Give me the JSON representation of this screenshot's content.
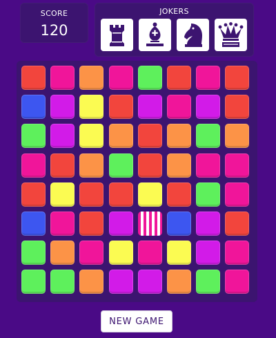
{
  "score": {
    "label": "SCORE",
    "value": "120"
  },
  "jokers": {
    "label": "JOKERS",
    "items": [
      {
        "piece": "rook",
        "icon": "rook-icon"
      },
      {
        "piece": "bishop",
        "icon": "bishop-icon"
      },
      {
        "piece": "knight",
        "icon": "knight-icon"
      },
      {
        "piece": "queen",
        "icon": "queen-icon"
      }
    ]
  },
  "colors": {
    "background": "#4a0a86",
    "panel": "#3c1470",
    "red": "#f2453d",
    "magenta": "#f0159a",
    "orange": "#fc9347",
    "green": "#5ef05c",
    "blue": "#3d56f0",
    "violet": "#d21be8",
    "yellow": "#fbfb52",
    "striped": "magenta-white-stripes"
  },
  "board": {
    "rows": 8,
    "cols": 8,
    "tiles": [
      [
        "red",
        "magenta",
        "orange",
        "magenta",
        "green",
        "red",
        "magenta",
        "red"
      ],
      [
        "blue",
        "violet",
        "yellow",
        "red",
        "violet",
        "magenta",
        "violet",
        "red"
      ],
      [
        "green",
        "violet",
        "yellow",
        "orange",
        "red",
        "orange",
        "green",
        "orange"
      ],
      [
        "magenta",
        "red",
        "orange",
        "green",
        "red",
        "orange",
        "magenta",
        "magenta"
      ],
      [
        "red",
        "yellow",
        "red",
        "red",
        "yellow",
        "red",
        "green",
        "magenta"
      ],
      [
        "blue",
        "magenta",
        "red",
        "violet",
        "striped",
        "blue",
        "violet",
        "red"
      ],
      [
        "green",
        "orange",
        "magenta",
        "yellow",
        "magenta",
        "yellow",
        "violet",
        "magenta"
      ],
      [
        "green",
        "green",
        "orange",
        "violet",
        "violet",
        "orange",
        "green",
        "magenta"
      ]
    ]
  },
  "new_game_label": "NEW GAME"
}
